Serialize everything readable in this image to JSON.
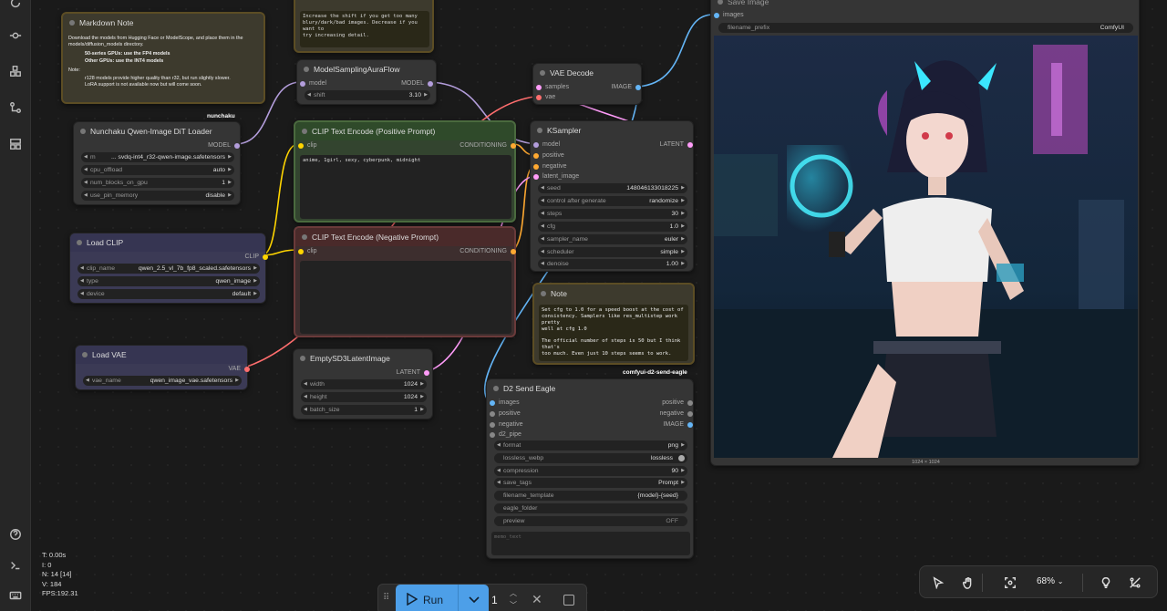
{
  "stats": {
    "t": "T: 0.00s",
    "i": "I: 0",
    "n": "N: 14 [14]",
    "v": "V: 184",
    "fps": "FPS:192.31"
  },
  "top_note": {
    "text": "Increase the shift if you get too many\nblury/dark/bad images. Decrease if you want to\ntry increasing detail."
  },
  "markdown_note": {
    "title": "Markdown Note",
    "line1": "Download the models from Hugging Face or ModelScope, and place them in the models/diffusion_models directory.",
    "bullet1": "50-series GPUs: use the FP4 models",
    "bullet2": "Other GPUs: use the INT4 models",
    "note_label": "Note:",
    "bullet3": "r128 models provide higher quality than r32, but run slightly slower.",
    "bullet4": "LoRA support is not available now but will come soon."
  },
  "brand_nunchaku": "nunchaku",
  "brand_send_eagle": "comfyui-d2-send-eagle",
  "dit_loader": {
    "title": "Nunchaku Qwen-Image DiT Loader",
    "out": "MODEL",
    "model_prefix": "m",
    "model_value": "... svdq-int4_r32-qwen-image.safetensors",
    "widgets": [
      {
        "label": "cpu_offload",
        "value": "auto"
      },
      {
        "label": "num_blocks_on_gpu",
        "value": "1"
      },
      {
        "label": "use_pin_memory",
        "value": "disable"
      }
    ]
  },
  "load_clip": {
    "title": "Load CLIP",
    "out": "CLIP",
    "widgets": [
      {
        "label": "clip_name",
        "value": "qwen_2.5_vl_7b_fp8_scaled.safetensors"
      },
      {
        "label": "type",
        "value": "qwen_image"
      },
      {
        "label": "device",
        "value": "default"
      }
    ]
  },
  "load_vae": {
    "title": "Load VAE",
    "out": "VAE",
    "widget": {
      "label": "vae_name",
      "value": "qwen_image_vae.safetensors"
    }
  },
  "model_sampling": {
    "title": "ModelSamplingAuraFlow",
    "in": "model",
    "out": "MODEL",
    "widget": {
      "label": "shift",
      "value": "3.10"
    }
  },
  "clip_pos": {
    "title": "CLIP Text Encode (Positive Prompt)",
    "in": "clip",
    "out": "CONDITIONING",
    "text": "anime, 1girl, sexy, cyberpunk, midnight"
  },
  "clip_neg": {
    "title": "CLIP Text Encode (Negative Prompt)",
    "in": "clip",
    "out": "CONDITIONING",
    "text": ""
  },
  "empty_latent": {
    "title": "EmptySD3LatentImage",
    "out": "LATENT",
    "widgets": [
      {
        "label": "width",
        "value": "1024"
      },
      {
        "label": "height",
        "value": "1024"
      },
      {
        "label": "batch_size",
        "value": "1"
      }
    ]
  },
  "vae_decode": {
    "title": "VAE Decode",
    "in1": "samples",
    "in2": "vae",
    "out": "IMAGE"
  },
  "ksampler": {
    "title": "KSampler",
    "inputs": [
      "model",
      "positive",
      "negative",
      "latent_image"
    ],
    "out": "LATENT",
    "widgets": [
      {
        "label": "seed",
        "value": "148046133018225"
      },
      {
        "label": "control after generate",
        "value": "randomize"
      },
      {
        "label": "steps",
        "value": "30"
      },
      {
        "label": "cfg",
        "value": "1.0"
      },
      {
        "label": "sampler_name",
        "value": "euler"
      },
      {
        "label": "scheduler",
        "value": "simple"
      },
      {
        "label": "denoise",
        "value": "1.00"
      }
    ]
  },
  "note2": {
    "title": "Note",
    "text": "Set cfg to 1.0 for a speed boost at the cost of\nconsistency. Samplers like res_multistep work pretty\nwell at cfg 1.0\n\nThe official number of steps is 50 but I think that's\ntoo much. Even just 10 steps seems to work."
  },
  "send_eagle": {
    "title": "D2 Send Eagle",
    "inputs": [
      "images",
      "positive",
      "negative",
      "d2_pipe"
    ],
    "outputs": [
      "positive",
      "negative",
      "IMAGE"
    ],
    "widgets": [
      {
        "label": "format",
        "value": "png"
      },
      {
        "label": "lossless_webp",
        "value": "lossless"
      },
      {
        "label": "compression",
        "value": "90"
      },
      {
        "label": "save_tags",
        "value": "Prompt"
      },
      {
        "label": "filename_template",
        "value": "{model}-{seed}"
      },
      {
        "label": "eagle_folder",
        "value": ""
      },
      {
        "label": "preview",
        "value": "OFF"
      }
    ],
    "memo_placeholder": "memo_text"
  },
  "save_image": {
    "title": "Save Image",
    "in": "images",
    "widget": {
      "label": "filename_prefix",
      "value": "ComfyUI"
    },
    "size_caption": "1024 × 1024"
  },
  "run": {
    "label": "Run",
    "batch": "1"
  },
  "toolbar": {
    "zoom": "68%"
  },
  "colors": {
    "model": "#b39ddb",
    "clip": "#ffd500",
    "conditioning": "#ffa931",
    "vae": "#ff6e6e",
    "latent": "#ff9cf9",
    "image": "#64b5f6"
  }
}
